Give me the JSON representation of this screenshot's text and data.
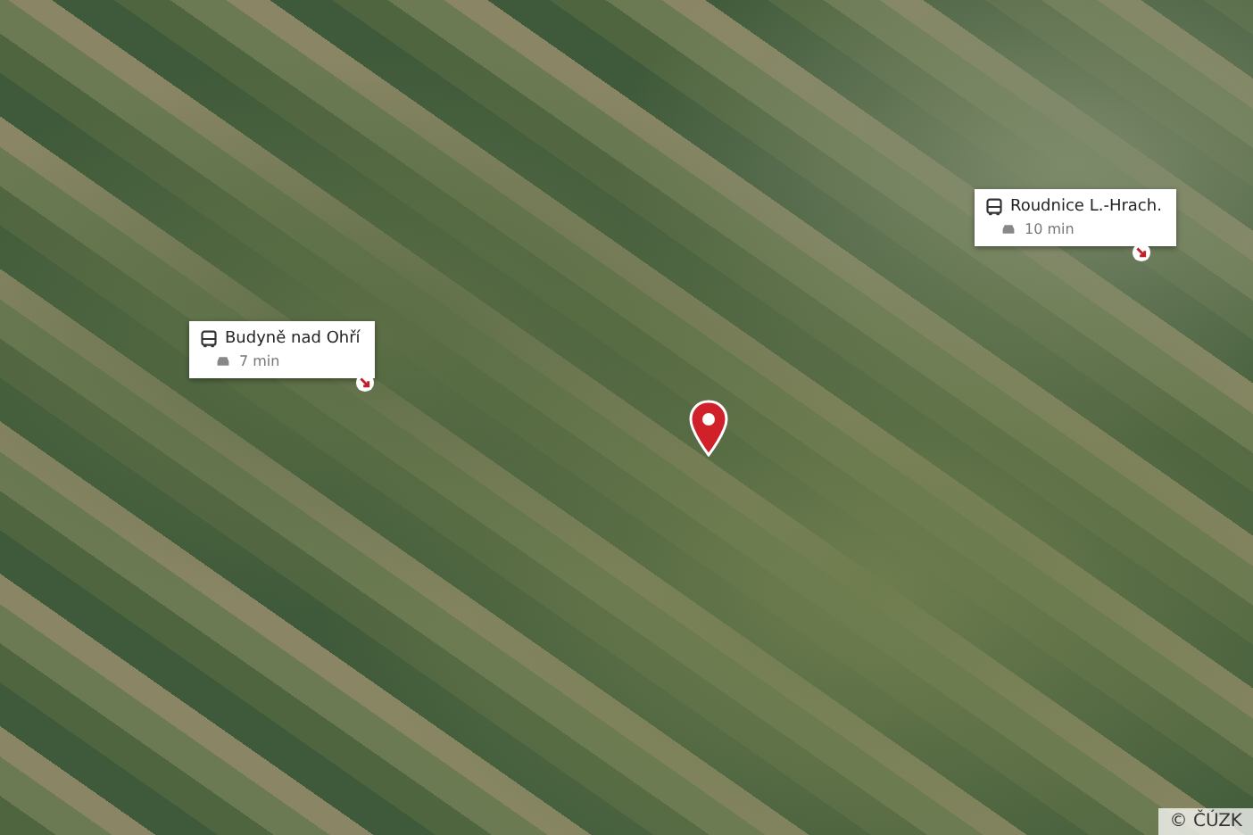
{
  "places": [
    {
      "name": "Budyně nad Ohří",
      "travel_time": "7 min"
    },
    {
      "name": "Roudnice L.-Hrach.",
      "travel_time": "10 min"
    }
  ],
  "attribution": "© ČÚZK"
}
